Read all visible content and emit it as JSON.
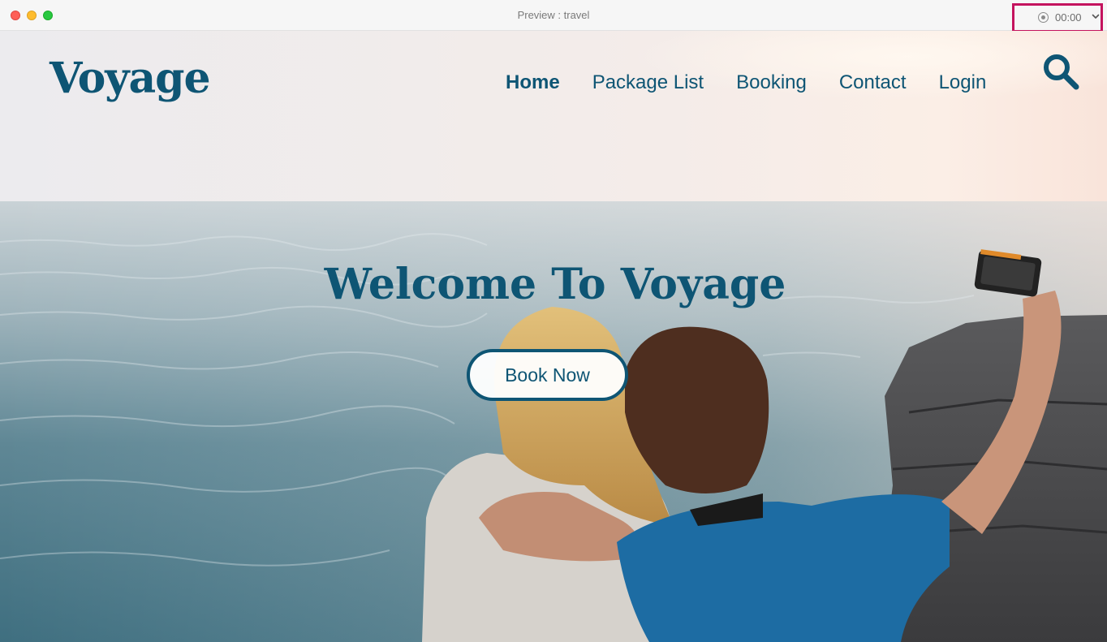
{
  "window": {
    "title": "Preview : travel",
    "recorder_time": "00:00"
  },
  "site": {
    "logo": "Voyage",
    "nav": [
      {
        "label": "Home",
        "active": true
      },
      {
        "label": "Package List",
        "active": false
      },
      {
        "label": "Booking",
        "active": false
      },
      {
        "label": "Contact",
        "active": false
      },
      {
        "label": "Login",
        "active": false
      }
    ],
    "search_icon": "search-icon"
  },
  "hero": {
    "headline": "Welcome To Voyage",
    "cta_label": "Book Now"
  },
  "colors": {
    "brand": "#0e5574",
    "recorder_highlight": "#c4135e"
  }
}
